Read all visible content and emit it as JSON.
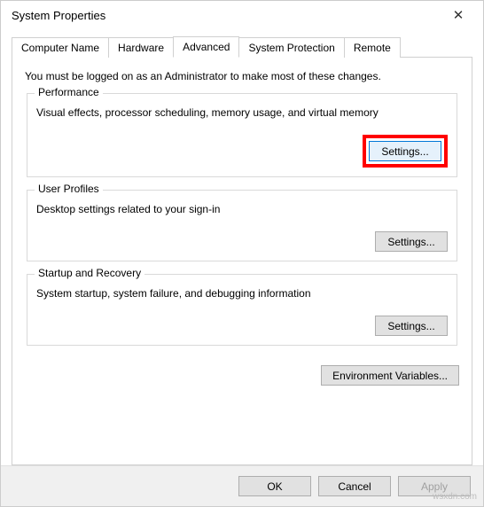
{
  "window": {
    "title": "System Properties",
    "close_glyph": "✕"
  },
  "tabs": {
    "computer_name": "Computer Name",
    "hardware": "Hardware",
    "advanced": "Advanced",
    "system_protection": "System Protection",
    "remote": "Remote"
  },
  "intro": "You must be logged on as an Administrator to make most of these changes.",
  "groups": {
    "performance": {
      "title": "Performance",
      "desc": "Visual effects, processor scheduling, memory usage, and virtual memory",
      "button": "Settings..."
    },
    "user_profiles": {
      "title": "User Profiles",
      "desc": "Desktop settings related to your sign-in",
      "button": "Settings..."
    },
    "startup_recovery": {
      "title": "Startup and Recovery",
      "desc": "System startup, system failure, and debugging information",
      "button": "Settings..."
    }
  },
  "env_button": "Environment Variables...",
  "buttons": {
    "ok": "OK",
    "cancel": "Cancel",
    "apply": "Apply"
  },
  "watermark": "wsxdn.com"
}
